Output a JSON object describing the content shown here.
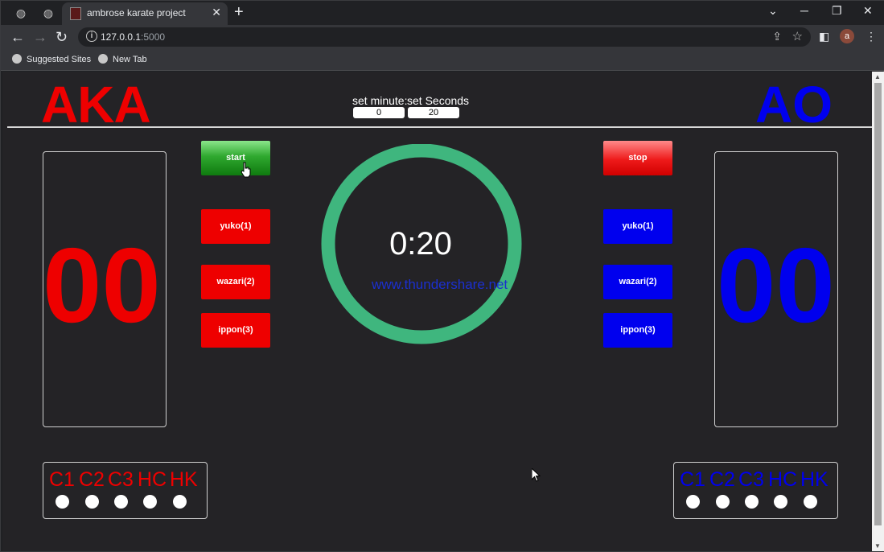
{
  "browser": {
    "tab_title": "ambrose karate project",
    "url_host": "127.0.0.1",
    "url_port": ":5000",
    "bookmarks": [
      "Suggested Sites",
      "New Tab"
    ],
    "profile_initial": "a"
  },
  "app": {
    "aka_title": "AKA",
    "ao_title": "AO",
    "set_minute_label": "set minute:",
    "set_seconds_label": "set Seconds",
    "minute_value": "0",
    "seconds_value": "20",
    "timer": "0:20",
    "timer_ring_fraction": 1.0,
    "watermark": "www.thundershare.net",
    "aka": {
      "score": "00",
      "buttons": {
        "start": "start",
        "yuko": "yuko(1)",
        "wazari": "wazari(2)",
        "ippon": "ippon(3)"
      },
      "penalties": [
        "C1",
        "C2",
        "C3",
        "HC",
        "HK"
      ]
    },
    "ao": {
      "score": "00",
      "buttons": {
        "stop": "stop",
        "yuko": "yuko(1)",
        "wazari": "wazari(2)",
        "ippon": "ippon(3)"
      },
      "penalties": [
        "C1",
        "C2",
        "C3",
        "HC",
        "HK"
      ]
    },
    "colors": {
      "aka": "#ee0000",
      "ao": "#0000ee",
      "ring": "#3fb67e",
      "start": "#2fa82f"
    }
  }
}
